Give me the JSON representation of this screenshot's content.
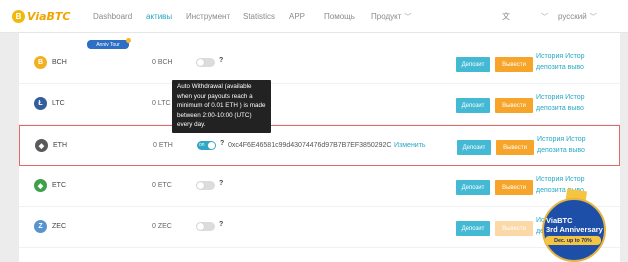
{
  "header": {
    "logo_letter": "B",
    "logo_text": "ViaBTC",
    "nav": [
      "Dashboard",
      "активы",
      "Инструмент",
      "Statistics",
      "APP",
      "Помощь",
      "Продукт"
    ],
    "language": "русский"
  },
  "tag": {
    "label": "Anniv Tour"
  },
  "tooltip": {
    "text": "Auto Withdrawal (available when your payouts reach a minimum of 0.01 ETH ) is made between 2:00-10:00 (UTC) every day."
  },
  "rows": [
    {
      "symbol": "BCH",
      "icon_letter": "B",
      "icon_color": "#f2b021",
      "balance": "0 BCH",
      "toggle_on": false,
      "toggle_label": "",
      "address": "",
      "change": "",
      "withdraw_enabled": true
    },
    {
      "symbol": "LTC",
      "icon_letter": "Ł",
      "icon_color": "#345d9d",
      "balance": "0 LTC",
      "toggle_on": false,
      "toggle_label": "",
      "address": "",
      "change": "",
      "withdraw_enabled": true
    },
    {
      "symbol": "ETH",
      "icon_letter": "◆",
      "icon_color": "#5a5a5a",
      "balance": "0 ETH",
      "toggle_on": true,
      "toggle_label": "on",
      "address": "0xc4F6E46581c99d43074476d97B7B7EF3850292C",
      "change": "Изменить",
      "withdraw_enabled": true
    },
    {
      "symbol": "ETC",
      "icon_letter": "◆",
      "icon_color": "#3ea14a",
      "balance": "0 ETC",
      "toggle_on": false,
      "toggle_label": "",
      "address": "",
      "change": "",
      "withdraw_enabled": true
    },
    {
      "symbol": "ZEC",
      "icon_letter": "Z",
      "icon_color": "#5793cf",
      "balance": "0 ZEC",
      "toggle_on": false,
      "toggle_label": "",
      "address": "",
      "change": "",
      "withdraw_enabled": false
    }
  ],
  "buttons": {
    "deposit": "Депозит",
    "withdraw": "Вывести"
  },
  "links": {
    "line1": "История  Истор",
    "line2": "депозита выво"
  },
  "badge": {
    "title": "ViaBTC",
    "subtitle": "3rd Anniversary",
    "offer": "Dec. up to 70%"
  }
}
